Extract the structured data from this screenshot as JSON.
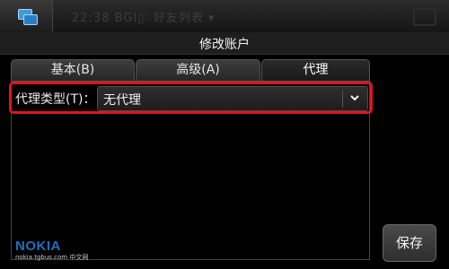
{
  "window": {
    "title": "修改账户"
  },
  "statusbar": {
    "faded_text": "22:38  BGI▯∶  好友列表  ▾"
  },
  "tabs": [
    {
      "label": "基本(B)",
      "selected": false
    },
    {
      "label": "高级(A)",
      "selected": false
    },
    {
      "label": "代理",
      "selected": true
    }
  ],
  "proxy": {
    "label": "代理类型(T)：",
    "value": "无代理"
  },
  "actions": {
    "save_label": "保存"
  },
  "watermark": {
    "brand": "NOKIA",
    "site": "nokia.tgbus.com 中文网"
  },
  "colors": {
    "highlight": "#e0141e",
    "brand": "#1f6fc0"
  }
}
